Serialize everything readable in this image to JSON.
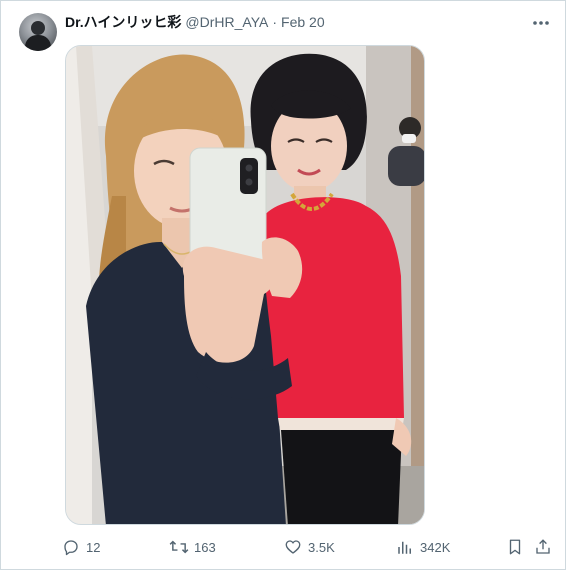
{
  "tweet": {
    "display_name": "Dr.ハインリッヒ彩",
    "handle": "@DrHR_AYA",
    "separator": "·",
    "date": "Feb 20",
    "more_icon": "more-horizontal-icon",
    "avatar": "avatar-photo"
  },
  "media": {
    "kind": "mirror-selfie-photo"
  },
  "actions": {
    "replies": "12",
    "retweets": "163",
    "likes": "3.5K",
    "views": "342K",
    "icons": [
      "reply-icon",
      "retweet-icon",
      "like-icon",
      "views-icon",
      "bookmark-icon",
      "share-icon"
    ]
  },
  "colors": {
    "text_primary": "#0f1419",
    "text_secondary": "#536471",
    "border": "#cfd9de"
  }
}
